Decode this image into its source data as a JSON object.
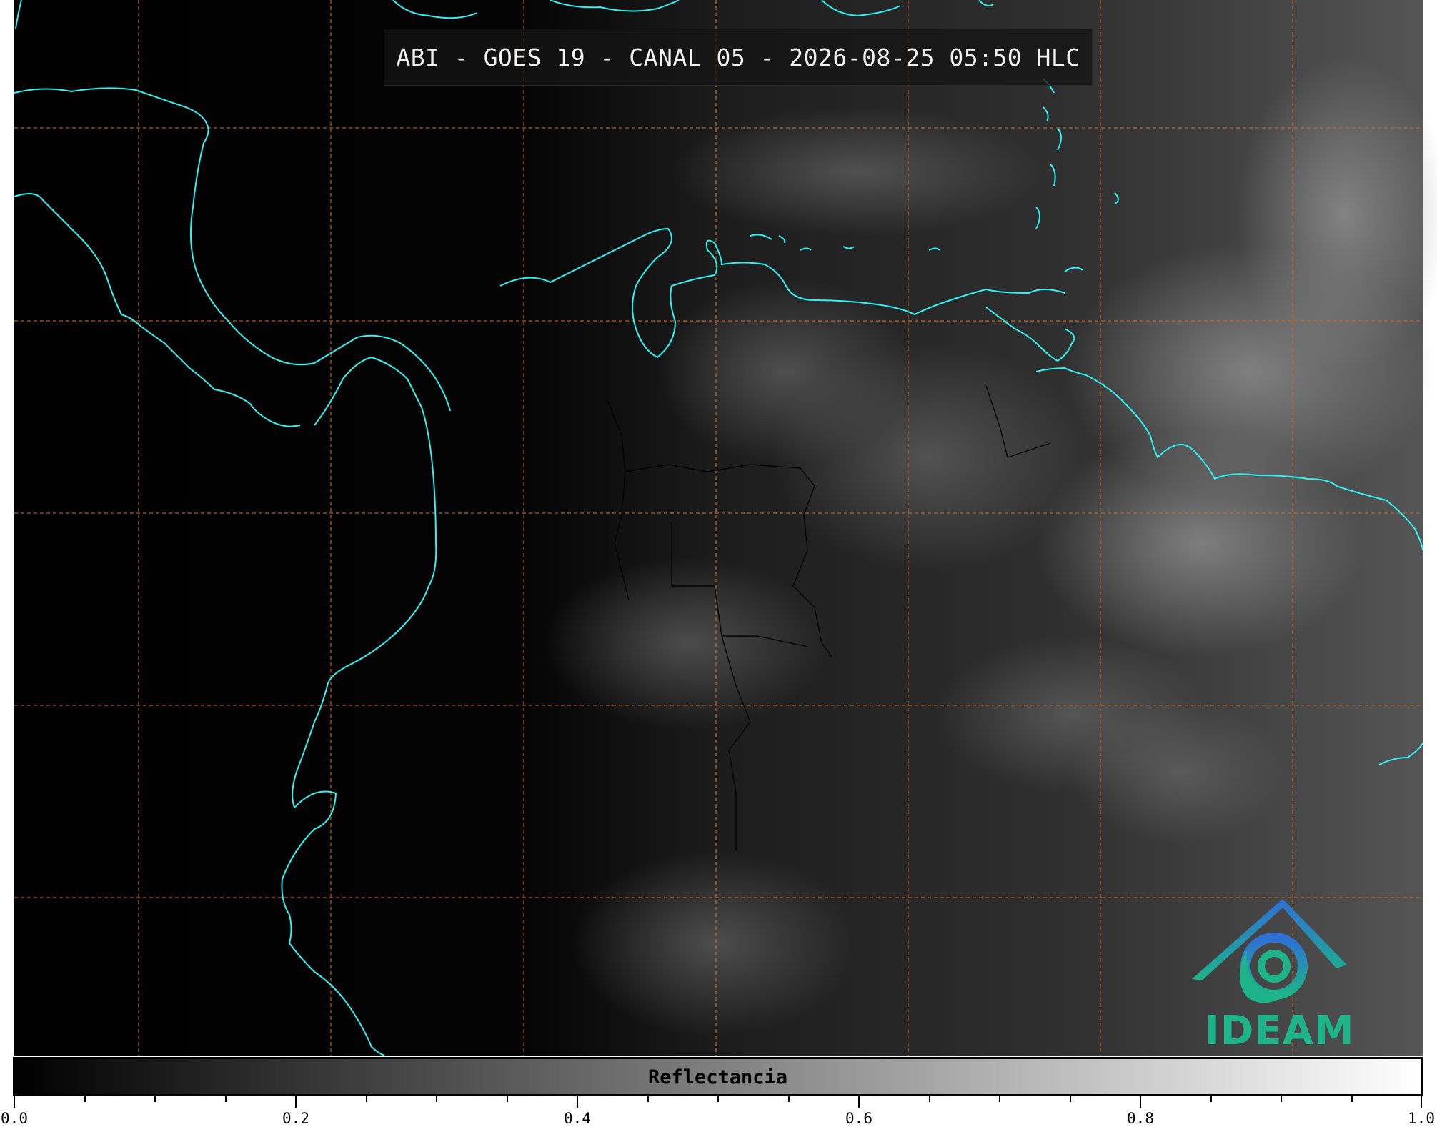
{
  "title": "ABI - GOES 19 - CANAL 05 - 2026-08-25 05:50 HLC",
  "logo_text": "IDEAM",
  "colorbar": {
    "label": "Reflectancia",
    "ticks": [
      "0.0",
      "0.2",
      "0.4",
      "0.6",
      "0.8",
      "1.0"
    ],
    "range": [
      0.0,
      1.0
    ],
    "colormap": [
      "#000000",
      "#ffffff"
    ]
  },
  "colors": {
    "coastline": "#2ef2f2",
    "borders": "#000000",
    "gridlines": "#d2691e",
    "title_bg": "#141414",
    "logo_blue": "#2f7fd6",
    "logo_green": "#1db489"
  },
  "map_features": {
    "coastlines": true,
    "country_borders": true,
    "graticule": "dashed"
  }
}
